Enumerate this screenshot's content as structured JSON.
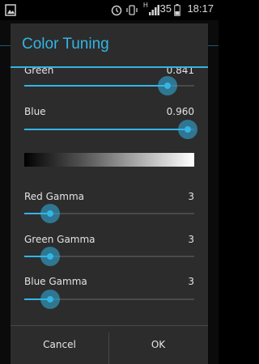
{
  "status_bar": {
    "time": "18:17",
    "battery_level": "35",
    "network_type": "H",
    "icons": [
      "image-icon",
      "alarm-icon",
      "vibrate-icon",
      "signal-icon",
      "battery-icon"
    ]
  },
  "dialog": {
    "title": "Color Tuning",
    "sliders": [
      {
        "label": "Green",
        "value": "0.841",
        "fraction": 0.841
      },
      {
        "label": "Blue",
        "value": "0.960",
        "fraction": 0.96
      },
      {
        "label": "Red Gamma",
        "value": "3",
        "fraction": 0.15
      },
      {
        "label": "Green Gamma",
        "value": "3",
        "fraction": 0.15
      },
      {
        "label": "Blue Gamma",
        "value": "3",
        "fraction": 0.15
      }
    ],
    "buttons": {
      "cancel": "Cancel",
      "ok": "OK"
    }
  },
  "colors": {
    "accent": "#33b5e5",
    "dialog_bg": "#2c2c2c"
  }
}
